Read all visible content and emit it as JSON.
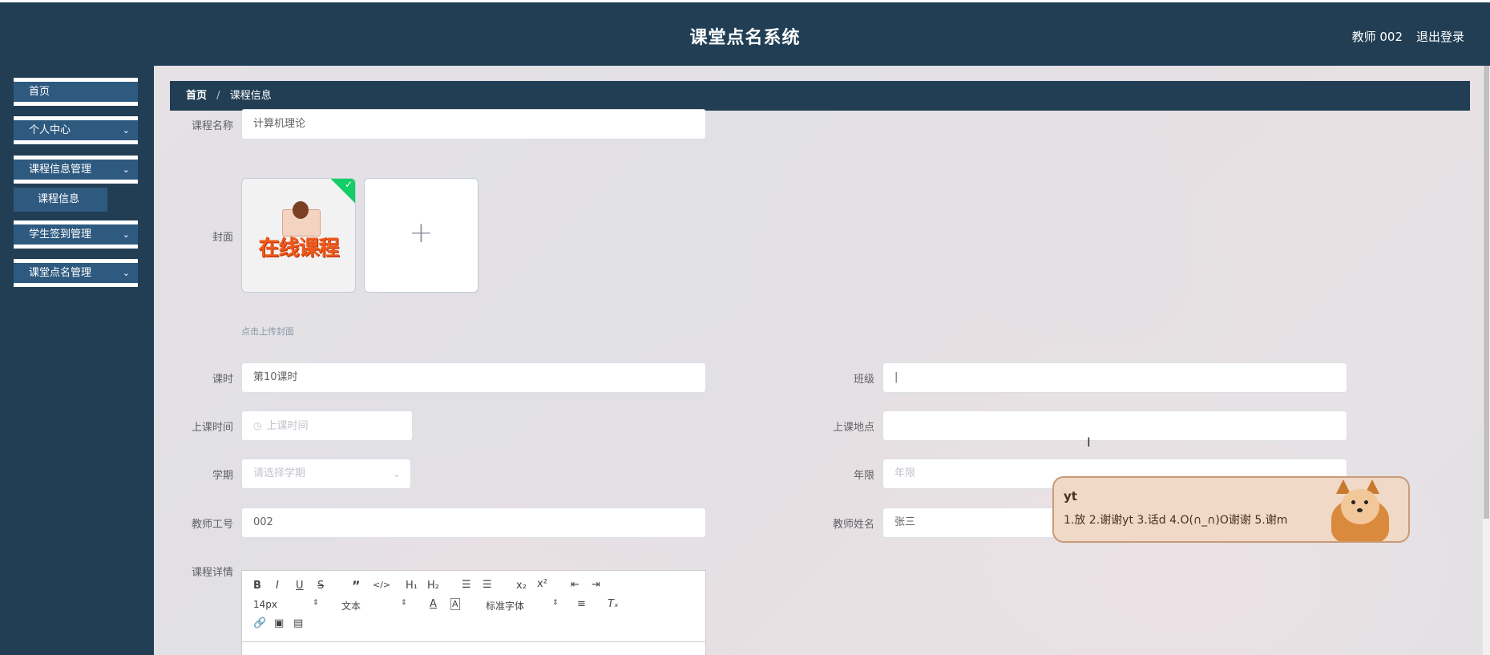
{
  "header": {
    "title": "课堂点名系统",
    "user": "教师 002",
    "logout": "退出登录"
  },
  "sidebar": {
    "items": [
      {
        "label": "首页",
        "has_arrow": false
      },
      {
        "label": "个人中心",
        "has_arrow": true
      },
      {
        "label": "课程信息管理",
        "has_arrow": true
      },
      {
        "label": "学生签到管理",
        "has_arrow": true
      },
      {
        "label": "课堂点名管理",
        "has_arrow": true
      }
    ],
    "sub_item": "课程信息"
  },
  "breadcrumb": {
    "home": "首页",
    "separator": "/",
    "current": "课程信息"
  },
  "form": {
    "course_name": {
      "label": "课程名称",
      "value": "计算机理论"
    },
    "cover": {
      "label": "封面",
      "image_text": "在线课程",
      "tip": "点击上传封面"
    },
    "lesson_hours": {
      "label": "课时",
      "value": "第10课时"
    },
    "class": {
      "label": "班级",
      "value": "|"
    },
    "class_time": {
      "label": "上课时间",
      "placeholder": "上课时间"
    },
    "location": {
      "label": "上课地点"
    },
    "term": {
      "label": "学期",
      "placeholder": "请选择学期"
    },
    "years": {
      "label": "年限",
      "placeholder": "年限"
    },
    "teacher_id": {
      "label": "教师工号",
      "value": "002"
    },
    "teacher_name": {
      "label": "教师姓名",
      "value": "张三"
    },
    "details": {
      "label": "课程详情"
    }
  },
  "editor": {
    "font_size": "14px",
    "paragraph": "文本",
    "font_family": "标准字体"
  },
  "ime": {
    "typed": "yt",
    "candidates": "1.放  2.谢谢yt  3.话d  4.O(∩_∩)O谢谢  5.谢m"
  },
  "colors": {
    "header_bg": "#213e54",
    "menu_bg": "#2f5a80",
    "success": "#13ce66"
  }
}
